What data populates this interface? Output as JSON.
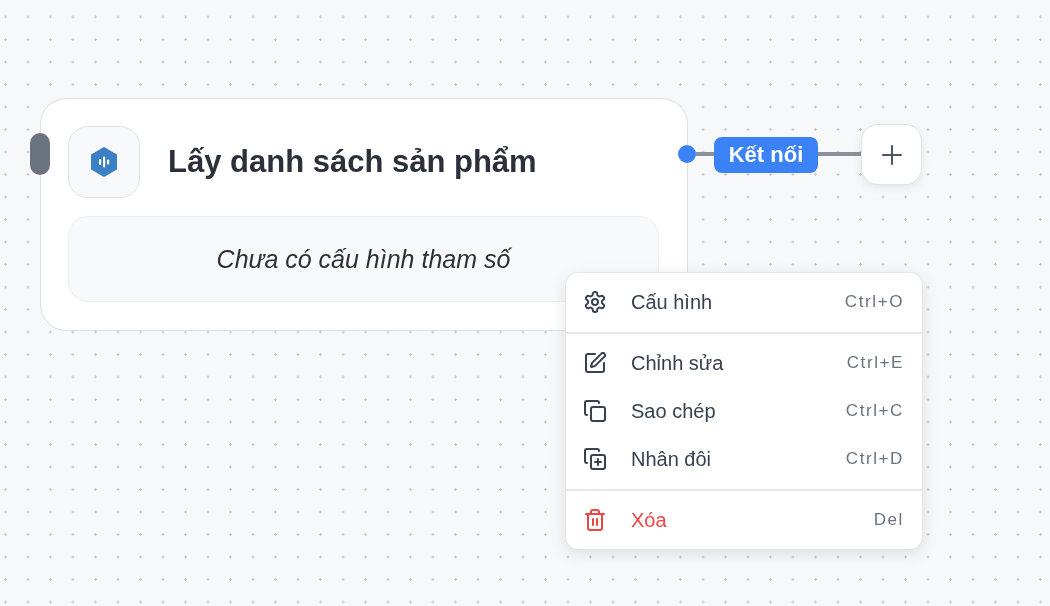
{
  "node": {
    "title": "Lấy danh sách sản phẩm",
    "parameters_message": "Chưa có cấu hình tham số"
  },
  "connection": {
    "label": "Kết nối"
  },
  "context_menu": {
    "groups": [
      {
        "items": [
          {
            "label": "Cấu hình",
            "shortcut": "Ctrl+O",
            "danger": false
          }
        ]
      },
      {
        "items": [
          {
            "label": "Chỉnh sửa",
            "shortcut": "Ctrl+E",
            "danger": false
          },
          {
            "label": "Sao chép",
            "shortcut": "Ctrl+C",
            "danger": false
          },
          {
            "label": "Nhân đôi",
            "shortcut": "Ctrl+D",
            "danger": false
          }
        ]
      },
      {
        "items": [
          {
            "label": "Xóa",
            "shortcut": "Del",
            "danger": true
          }
        ]
      }
    ]
  }
}
